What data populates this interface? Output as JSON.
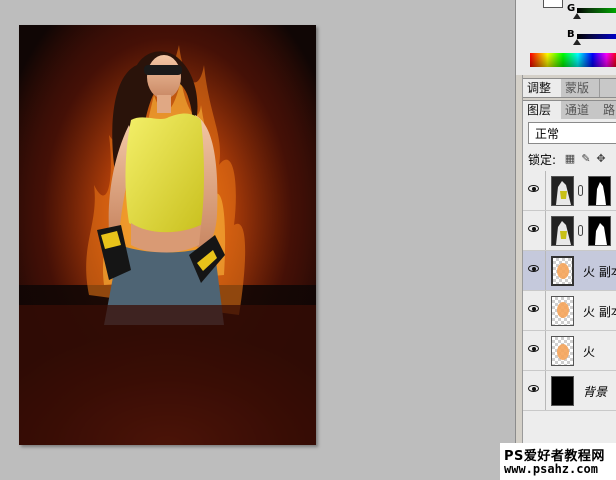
{
  "color_panel": {
    "sliders": [
      {
        "label": "G",
        "value": 0
      },
      {
        "label": "B",
        "value": 0
      }
    ]
  },
  "adjust_tabs": [
    {
      "label": "调整",
      "active": true
    },
    {
      "label": "蒙版",
      "active": false
    }
  ],
  "layers_tabs": [
    {
      "label": "图层",
      "active": true
    },
    {
      "label": "通道",
      "active": false
    },
    {
      "label": "路",
      "active": false
    }
  ],
  "layers_panel": {
    "blend_mode": "正常",
    "lock_label": "锁定:",
    "lock_icons": [
      "lock-transparent-icon",
      "lock-brush-icon",
      "lock-move-icon"
    ],
    "layers": [
      {
        "name": "",
        "thumbnail": "photo",
        "mask": true,
        "selected": false,
        "visible": true
      },
      {
        "name": "",
        "thumbnail": "photo",
        "mask": true,
        "selected": false,
        "visible": true
      },
      {
        "name": "火 副本",
        "thumbnail": "fire-transparent",
        "mask": false,
        "selected": true,
        "visible": true
      },
      {
        "name": "火 副本",
        "thumbnail": "fire-transparent",
        "mask": false,
        "selected": false,
        "visible": true
      },
      {
        "name": "火",
        "thumbnail": "fire-transparent",
        "mask": false,
        "selected": false,
        "visible": true
      },
      {
        "name": "背景",
        "thumbnail": "black",
        "mask": false,
        "selected": false,
        "visible": true,
        "italic": true
      }
    ]
  },
  "watermark": {
    "line1": "PS爱好者教程网",
    "line2": "www.psahz.com"
  },
  "colors": {
    "canvas_bg": "#bdbdbd",
    "panel_bg": "#ededed",
    "selected_layer": "#c5c9dc",
    "document_bg": "#100605",
    "fire_orange": "#ff9a1a"
  }
}
